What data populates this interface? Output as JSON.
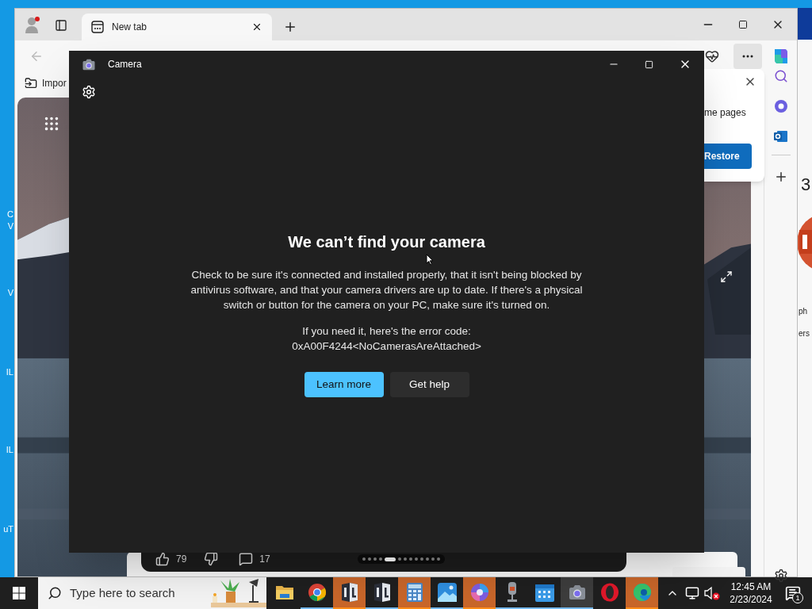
{
  "desktop": {
    "icon_labels": [
      "C",
      "V",
      "V",
      "IL",
      "IL",
      "uT"
    ]
  },
  "browser": {
    "tabs": [
      {
        "title": "New tab",
        "selected": true
      }
    ],
    "favorites": [
      {
        "label": "Impor"
      }
    ],
    "restore_popup": {
      "text": "me pages",
      "button": "Restore"
    },
    "feed_card": {
      "likes": "79",
      "comments": "17",
      "pages": [
        {
          "selected": false
        },
        {
          "selected": false
        },
        {
          "selected": false
        },
        {
          "selected": false
        },
        {
          "selected": true
        },
        {
          "selected": false
        },
        {
          "selected": false
        },
        {
          "selected": false
        },
        {
          "selected": false
        },
        {
          "selected": false
        },
        {
          "selected": false
        },
        {
          "selected": false
        },
        {
          "selected": false
        }
      ]
    }
  },
  "side_window": {
    "heading": "3",
    "lines": [
      "ph",
      "ers"
    ]
  },
  "camera_app": {
    "title": "Camera",
    "heading": "We can’t find your camera",
    "message": "Check to be sure it's connected and installed properly, that it isn't being blocked by antivirus software, and that your camera drivers are up to date. If there's a physical switch or button for the camera on your PC, make sure it's turned on.",
    "error_label": "If you need it, here's the error code:",
    "error_code": "0xA00F4244<NoCamerasAreAttached>",
    "buttons": [
      {
        "label": "Learn more",
        "kind": "primary"
      },
      {
        "label": "Get help",
        "kind": "secondary"
      }
    ]
  },
  "taskbar": {
    "search_placeholder": "Type here to search",
    "apps": [
      {
        "kind": "folder",
        "flashing": false,
        "running": false,
        "selected": false
      },
      {
        "kind": "chrome",
        "flashing": false,
        "running": true,
        "selected": false
      },
      {
        "kind": "il",
        "flashing": true,
        "running": true,
        "selected": false
      },
      {
        "kind": "il",
        "flashing": false,
        "running": true,
        "selected": false
      },
      {
        "kind": "calculator",
        "flashing": true,
        "running": true,
        "selected": false
      },
      {
        "kind": "photos",
        "flashing": false,
        "running": true,
        "selected": false
      },
      {
        "kind": "copilot",
        "flashing": true,
        "running": true,
        "selected": false
      },
      {
        "kind": "microphone",
        "flashing": false,
        "running": true,
        "selected": false
      },
      {
        "kind": "calendar",
        "flashing": false,
        "running": true,
        "selected": false
      },
      {
        "kind": "camera",
        "flashing": false,
        "running": true,
        "selected": true
      },
      {
        "kind": "opera",
        "flashing": false,
        "running": false,
        "selected": false
      },
      {
        "kind": "edge",
        "flashing": true,
        "running": true,
        "selected": false
      }
    ],
    "volume_muted": true,
    "clock": {
      "time": "12:45 AM",
      "date": "2/23/2024"
    },
    "notifications": "1"
  }
}
